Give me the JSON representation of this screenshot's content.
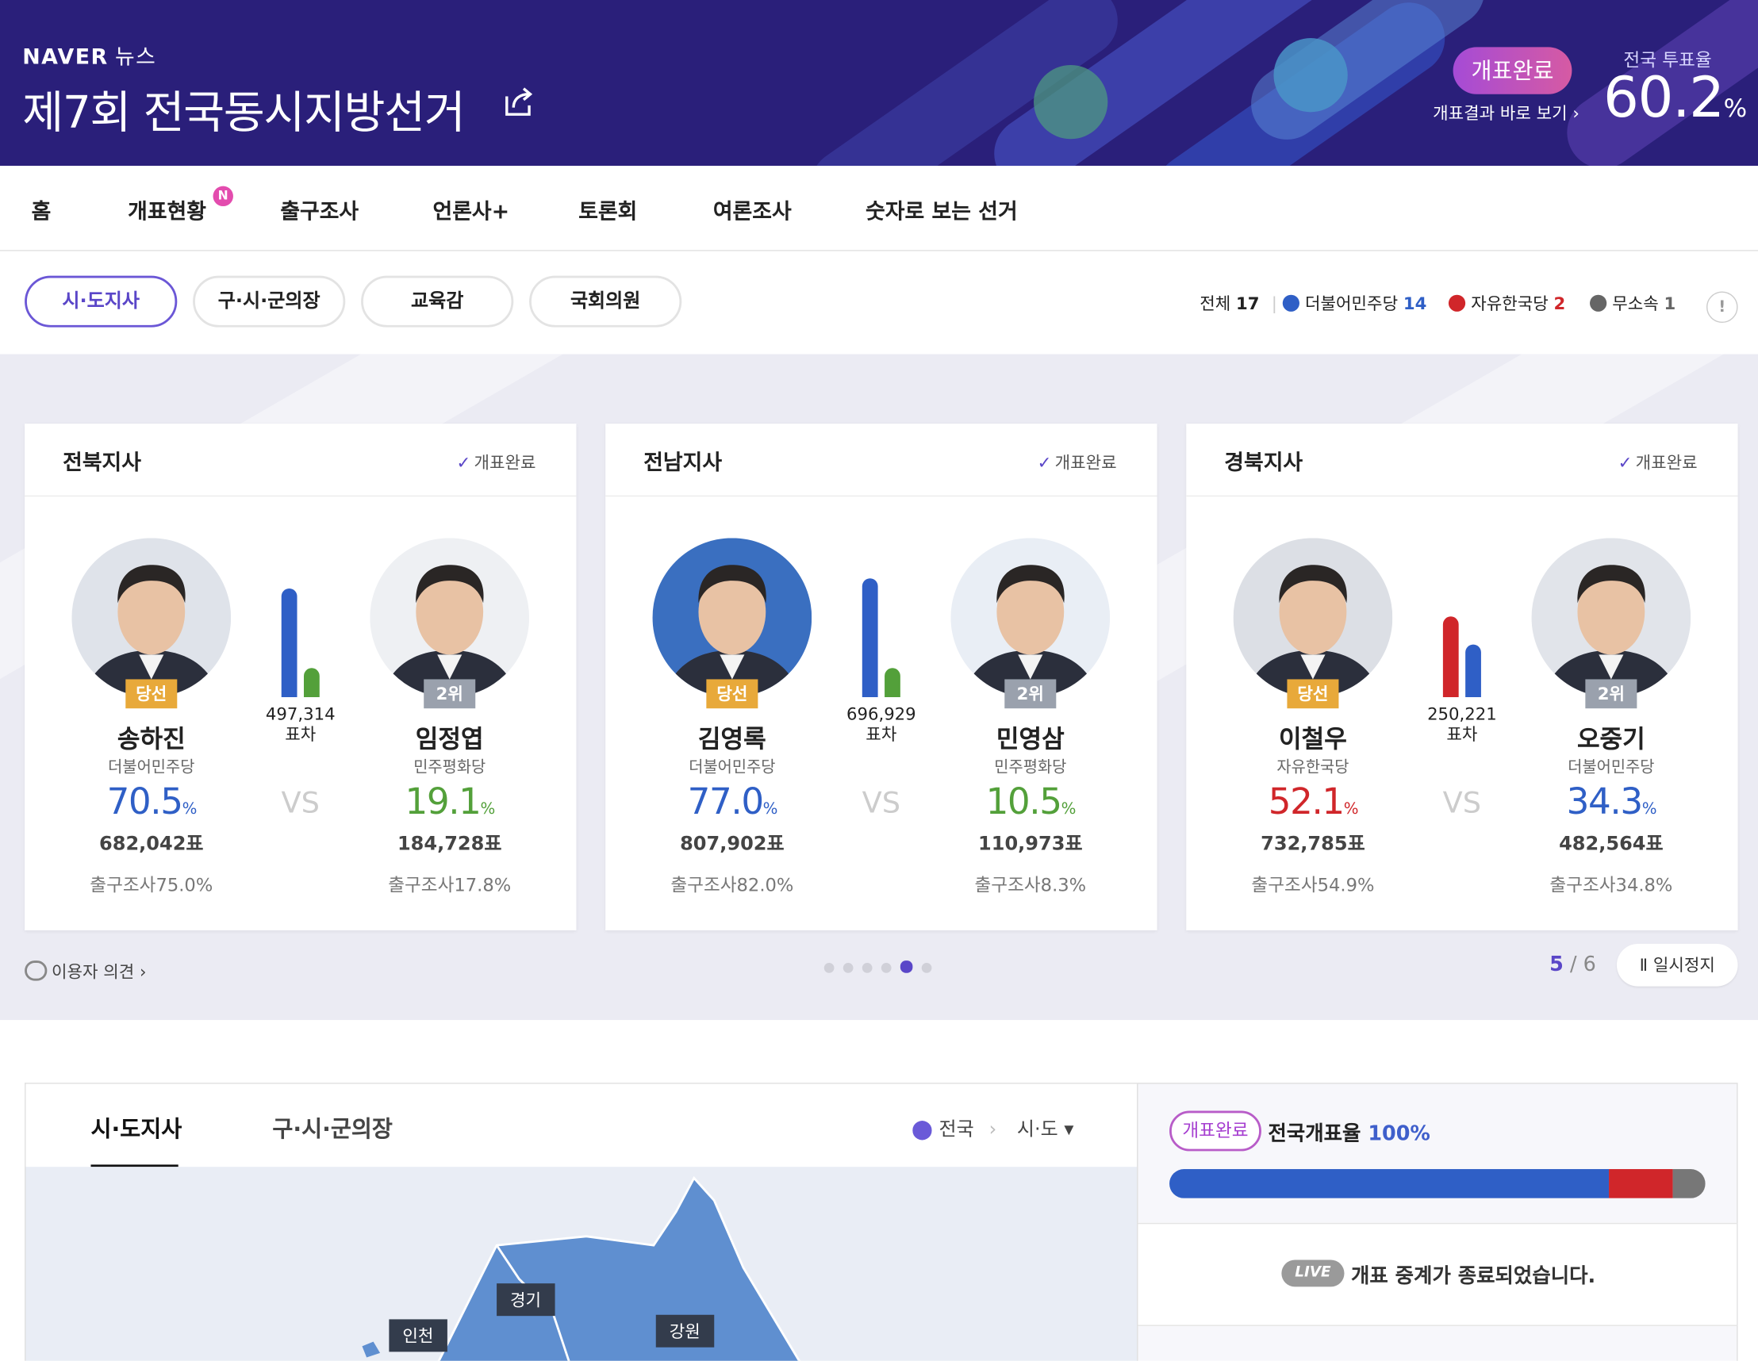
{
  "header": {
    "logo": "NAVER",
    "logo_sub": "뉴스",
    "title": "제7회 전국동시지방선거",
    "status_pill": "개표완료",
    "result_link": "개표결과 바로 보기",
    "turnout_label": "전국 투표율",
    "turnout_value": "60.2",
    "turnout_unit": "%"
  },
  "nav": {
    "items": [
      "홈",
      "개표현황",
      "출구조사",
      "언론사+",
      "토론회",
      "여론조사",
      "숫자로 보는 선거"
    ],
    "new_badge": "N"
  },
  "filters": {
    "items": [
      "시·도지사",
      "구·시·군의장",
      "교육감",
      "국회의원"
    ],
    "selected": "시·도지사"
  },
  "summary": {
    "total_label": "전체",
    "total": "17",
    "parties": [
      {
        "name": "더불어민주당",
        "count": "14",
        "color": "#2f5fc6"
      },
      {
        "name": "자유한국당",
        "count": "2",
        "color": "#d0262a"
      },
      {
        "name": "무소속",
        "count": "1",
        "color": "#666666"
      }
    ],
    "info": "!"
  },
  "cards": [
    {
      "region": "전북지사",
      "status": "개표완료",
      "gap": "497,314",
      "gap_unit": "표차",
      "vs": "VS",
      "winner": {
        "badge": "당선",
        "name": "송하진",
        "party": "더불어민주당",
        "pct": "70.5",
        "votes": "682,042표",
        "exit": "출구조사75.0%",
        "color": "#2f5fc6"
      },
      "runner": {
        "badge": "2위",
        "name": "임정엽",
        "party": "민주평화당",
        "pct": "19.1",
        "votes": "184,728표",
        "exit": "출구조사17.8%",
        "color": "#53a03a"
      },
      "bars": {
        "winner": 70.5,
        "runner": 19.1
      }
    },
    {
      "region": "전남지사",
      "status": "개표완료",
      "gap": "696,929",
      "gap_unit": "표차",
      "vs": "VS",
      "winner": {
        "badge": "당선",
        "name": "김영록",
        "party": "더불어민주당",
        "pct": "77.0",
        "votes": "807,902표",
        "exit": "출구조사82.0%",
        "color": "#2f5fc6"
      },
      "runner": {
        "badge": "2위",
        "name": "민영삼",
        "party": "민주평화당",
        "pct": "10.5",
        "votes": "110,973표",
        "exit": "출구조사8.3%",
        "color": "#53a03a"
      },
      "bars": {
        "winner": 77.0,
        "runner": 10.5
      }
    },
    {
      "region": "경북지사",
      "status": "개표완료",
      "gap": "250,221",
      "gap_unit": "표차",
      "vs": "VS",
      "winner": {
        "badge": "당선",
        "name": "이철우",
        "party": "자유한국당",
        "pct": "52.1",
        "votes": "732,785표",
        "exit": "출구조사54.9%",
        "color": "#d0262a"
      },
      "runner": {
        "badge": "2위",
        "name": "오중기",
        "party": "더불어민주당",
        "pct": "34.3",
        "votes": "482,564표",
        "exit": "출구조사34.8%",
        "color": "#2f5fc6"
      },
      "bars": {
        "winner": 52.1,
        "runner": 34.3
      }
    }
  ],
  "carousel": {
    "opinion": "이용자 의견",
    "current": "5",
    "total": "6",
    "sep": "/",
    "pause": "일시정지",
    "dots": 6,
    "active_dot": 5
  },
  "map": {
    "tabs": [
      "시·도지사",
      "구·시·군의장"
    ],
    "location": "전국",
    "level": "시·도",
    "regions": [
      "경기",
      "인천",
      "강원"
    ]
  },
  "side": {
    "pill": "개표완료",
    "rate_label": "전국개표율",
    "rate_value": "100%",
    "live_badge": "LIVE",
    "live_text": "개표 중계가 종료되었습니다.",
    "progress": [
      {
        "party": "더불어민주당",
        "share": 0.82,
        "color": "#2f5fc6"
      },
      {
        "party": "자유한국당",
        "share": 0.12,
        "color": "#d0262a"
      },
      {
        "party": "무소속",
        "share": 0.06,
        "color": "#777777"
      }
    ]
  }
}
